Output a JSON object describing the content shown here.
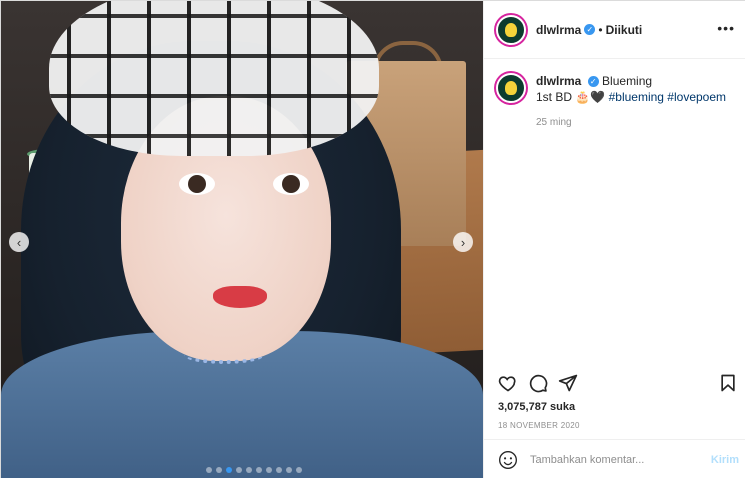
{
  "post": {
    "username": "dlwlrma",
    "follow_status": "Diikuti",
    "more_glyph": "•••",
    "separator": "•",
    "caption": {
      "username": "dlwlrma",
      "title": "Blueming",
      "line2_prefix": "1st BD",
      "emoji": "🎂🖤",
      "hashtags": "#blueming #lovepoem",
      "time_ago": "25 ming"
    },
    "likes": "3,075,787 suka",
    "date": "18 NOVEMBER 2020",
    "comment": {
      "placeholder": "Tambahkan komentar...",
      "send_label": "Kirim"
    },
    "carousel": {
      "prev_glyph": "‹",
      "next_glyph": "›",
      "slide_count": 10,
      "active_index": 2
    },
    "icons": {
      "like": "heart-icon",
      "comment": "comment-icon",
      "share": "share-icon",
      "save": "bookmark-icon",
      "verified": "verified-icon",
      "emoji": "smile-icon"
    },
    "colors": {
      "accent": "#3897f0",
      "hashtag": "#00376b",
      "muted": "#8e8e8e",
      "send_disabled": "#b2dffc"
    }
  }
}
